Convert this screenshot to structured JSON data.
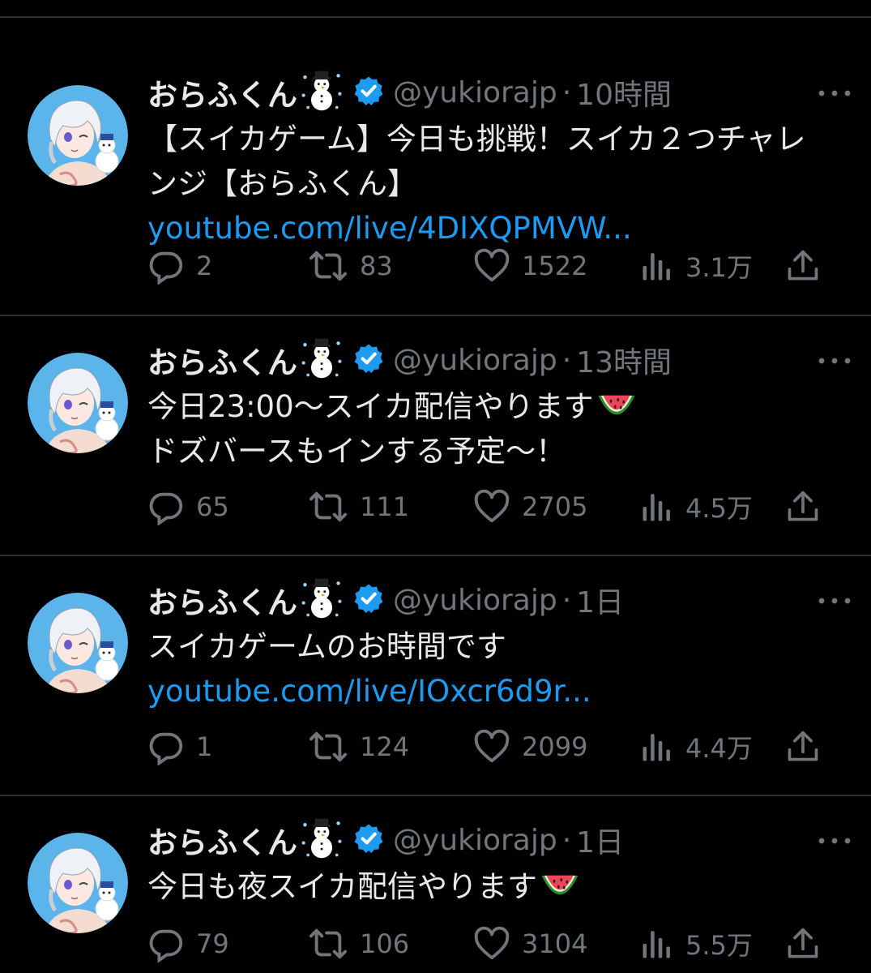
{
  "tweets": [
    {
      "name": "おらふくん",
      "handle": "@yukiorajp",
      "dot": "·",
      "time": "10時間",
      "lines": [
        "【スイカゲーム】今日も挑戦！スイカ２つチャレ",
        "ンジ【おらふくん】"
      ],
      "link": "youtube.com/live/4DIXQPMVW...",
      "replies": "2",
      "retweets": "83",
      "likes": "1522",
      "views": "3.1万"
    },
    {
      "name": "おらふくん",
      "handle": "@yukiorajp",
      "dot": "·",
      "time": "13時間",
      "lines": [
        "今日23:00〜スイカ配信やります",
        "ドズバースもインする予定〜！"
      ],
      "link": "",
      "replies": "65",
      "retweets": "111",
      "likes": "2705",
      "views": "4.5万"
    },
    {
      "name": "おらふくん",
      "handle": "@yukiorajp",
      "dot": "·",
      "time": "1日",
      "lines": [
        "スイカゲームのお時間です"
      ],
      "link": "youtube.com/live/IOxcr6d9r...",
      "replies": "1",
      "retweets": "124",
      "likes": "2099",
      "views": "4.4万"
    },
    {
      "name": "おらふくん",
      "handle": "@yukiorajp",
      "dot": "·",
      "time": "1日",
      "lines": [
        "今日も夜スイカ配信やります"
      ],
      "link": "",
      "replies": "79",
      "retweets": "106",
      "likes": "3104",
      "views": "5.5万"
    }
  ],
  "colors": {
    "background": "#000000",
    "text": "#e7e9ea",
    "muted": "#71767b",
    "link": "#1d9bf0",
    "verified": "#1d9bf0",
    "divider": "#2f3336"
  },
  "icons": {
    "reply": "reply-bubble-icon",
    "retweet": "retweet-icon",
    "like": "heart-icon",
    "views": "views-bar-chart-icon",
    "share": "share-upload-icon",
    "more": "more-dots-icon",
    "verified": "verified-badge-icon",
    "emoji_name": "snowman-emoji",
    "emoji_body": "watermelon-emoji"
  }
}
